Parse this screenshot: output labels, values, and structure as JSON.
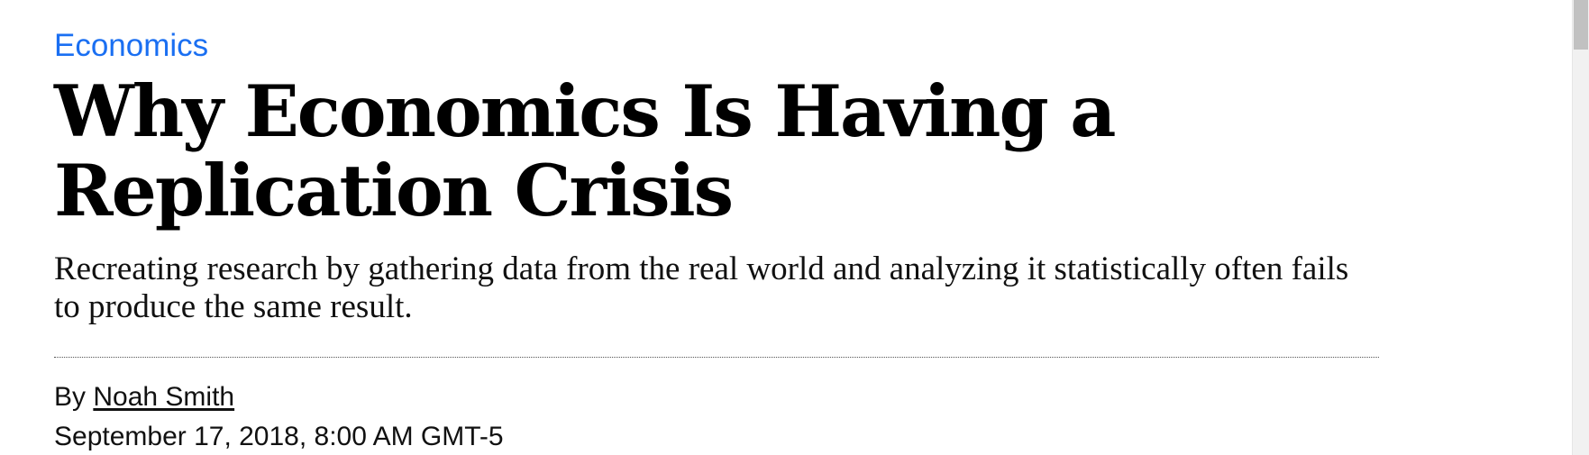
{
  "article": {
    "category": "Economics",
    "headline": "Why Economics Is Having a Replication Crisis",
    "dek": "Recreating research by gathering data from the real world and analyzing it statistically often fails to produce the same result.",
    "byline_prefix": "By",
    "author": "Noah Smith",
    "timestamp": "September 17, 2018, 8:00 AM GMT-5"
  },
  "colors": {
    "category_link": "#1a6ff2",
    "text": "#000000",
    "scrollbar_track": "#f1f1f1",
    "scrollbar_thumb": "#c1c1c1"
  }
}
